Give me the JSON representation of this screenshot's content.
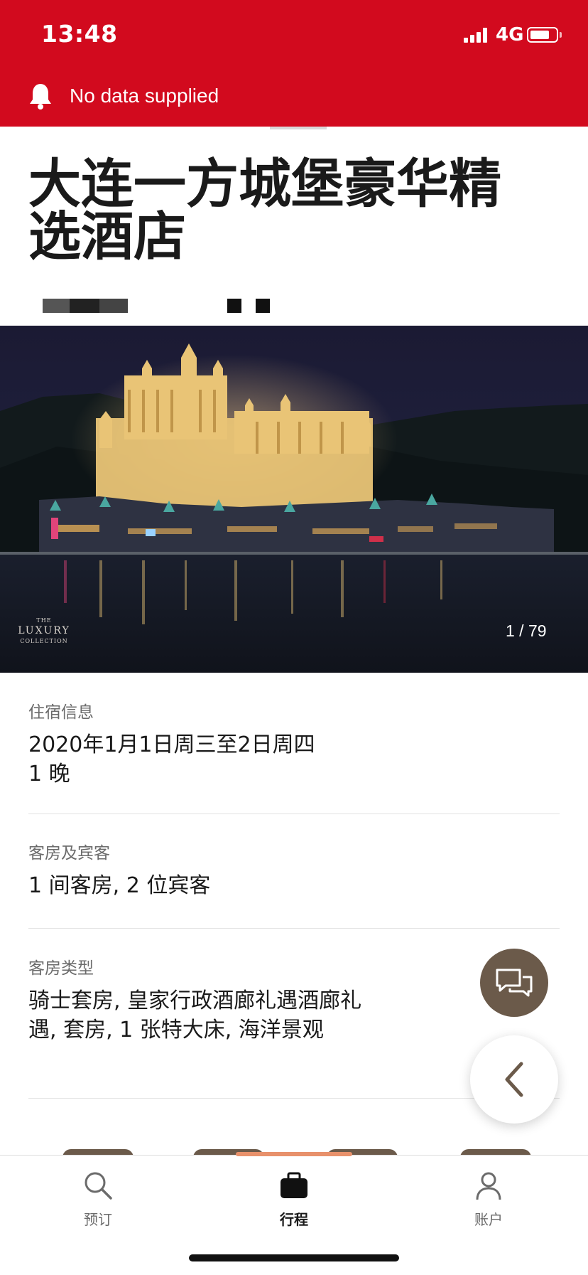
{
  "status_bar": {
    "time": "13:48",
    "network": "4G",
    "battery_level": 0.75
  },
  "notice": {
    "icon": "bell-icon",
    "text": "No data supplied"
  },
  "hotel": {
    "name": "大连一方城堡豪华精选酒店"
  },
  "hero": {
    "brand_small_top": "THE",
    "brand_main": "LUXURY",
    "brand_small_bottom": "COLLECTION",
    "photo_counter": "1 / 79"
  },
  "stay": {
    "label": "住宿信息",
    "dates": "2020年1月1日周三至2日周四",
    "nights": "1 晚"
  },
  "guests": {
    "label": "客房及宾客",
    "value": "1 间客房, 2 位宾客"
  },
  "room_type": {
    "label": "客房类型",
    "value": "骑士套房, 皇家行政酒廊礼遇酒廊礼遇, 套房, 1 张特大床, 海洋景观"
  },
  "fabs": {
    "chat_icon": "chat-icon",
    "back_icon": "chevron-left-icon"
  },
  "tab_bar": {
    "tabs": [
      {
        "label": "预订",
        "icon": "search-icon",
        "active": false
      },
      {
        "label": "行程",
        "icon": "briefcase-icon",
        "active": true
      },
      {
        "label": "账户",
        "icon": "person-icon",
        "active": false
      }
    ]
  },
  "colors": {
    "brand_red": "#d20a1e",
    "accent_brown": "#6b5a4a",
    "tab_indicator": "#e8916b"
  }
}
